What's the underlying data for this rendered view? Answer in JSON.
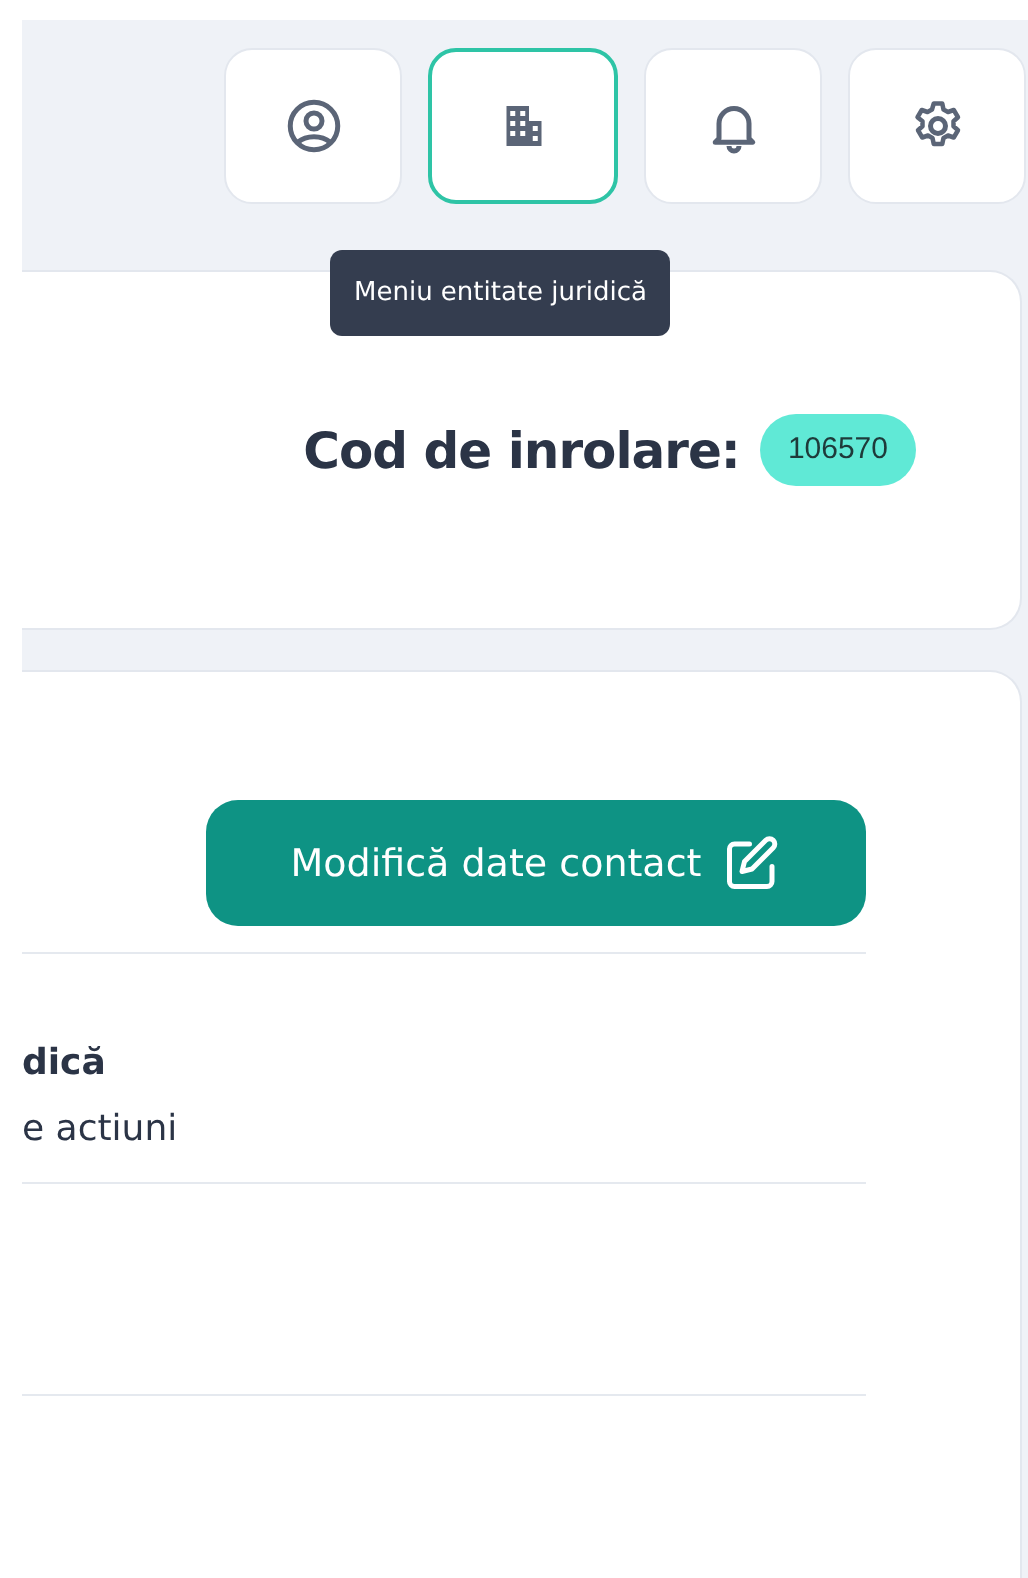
{
  "toolbar": {
    "buttons": [
      {
        "kind": "user",
        "selected": false
      },
      {
        "kind": "building",
        "selected": true
      },
      {
        "kind": "bell",
        "selected": false
      },
      {
        "kind": "gear",
        "selected": false
      }
    ]
  },
  "tooltip": "Meniu entitate juridică",
  "enrollment": {
    "label": "Cod de inrolare:",
    "code": "106570"
  },
  "contact": {
    "button": "Modifică date contact",
    "title": "dică",
    "subtitle": "e actiuni"
  }
}
